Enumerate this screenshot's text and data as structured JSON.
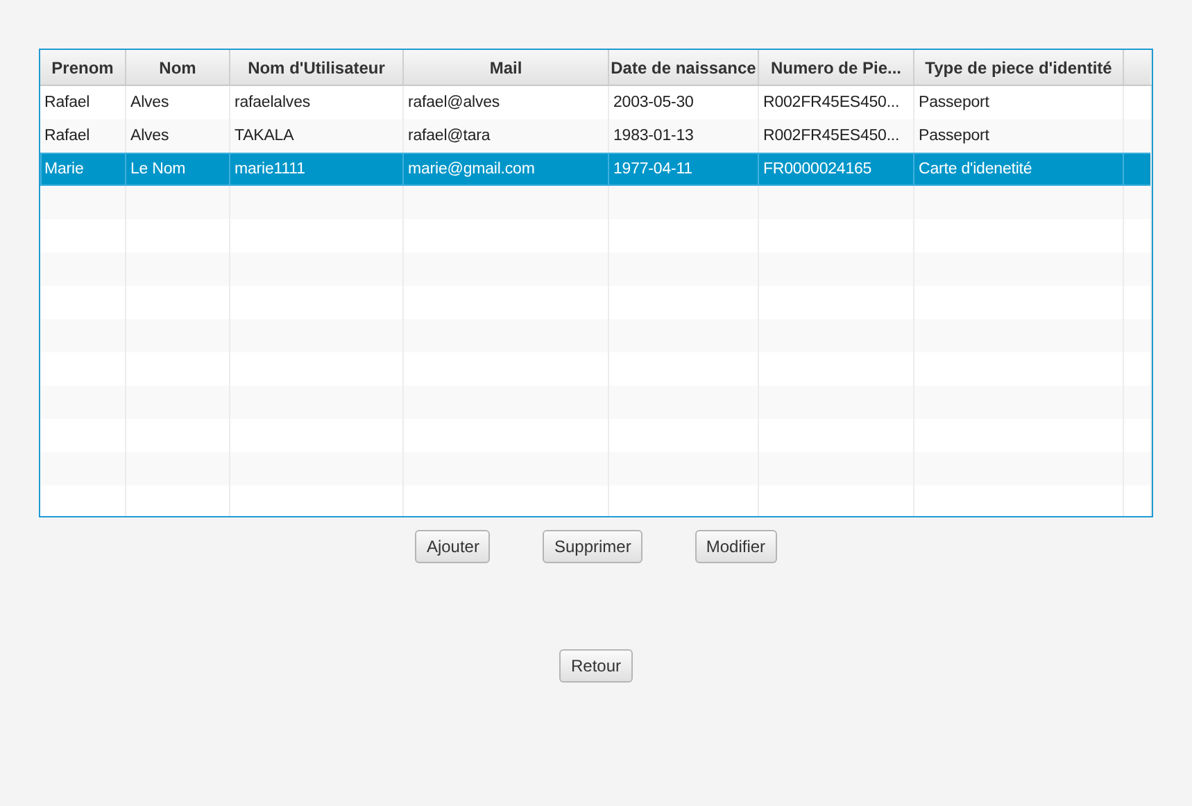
{
  "table": {
    "columns": [
      "Prenom",
      "Nom",
      "Nom d'Utilisateur",
      "Mail",
      "Date de naissance",
      "Numero de Pie...",
      "Type de piece d'identité"
    ],
    "rows": [
      {
        "cells": [
          "Rafael",
          "Alves",
          "rafaelalves",
          "rafael@alves",
          "2003-05-30",
          "R002FR45ES450...",
          "Passeport"
        ],
        "selected": false
      },
      {
        "cells": [
          "Rafael",
          "Alves",
          "TAKALA",
          "rafael@tara",
          "1983-01-13",
          "R002FR45ES450...",
          "Passeport"
        ],
        "selected": false
      },
      {
        "cells": [
          "Marie",
          "Le Nom",
          "marie1111",
          "marie@gmail.com",
          "1977-04-11",
          "FR0000024165",
          "Carte d'idenetité"
        ],
        "selected": true
      }
    ]
  },
  "actions": [
    "Ajouter",
    "Supprimer",
    "Modifier"
  ],
  "back_button": "Retour"
}
